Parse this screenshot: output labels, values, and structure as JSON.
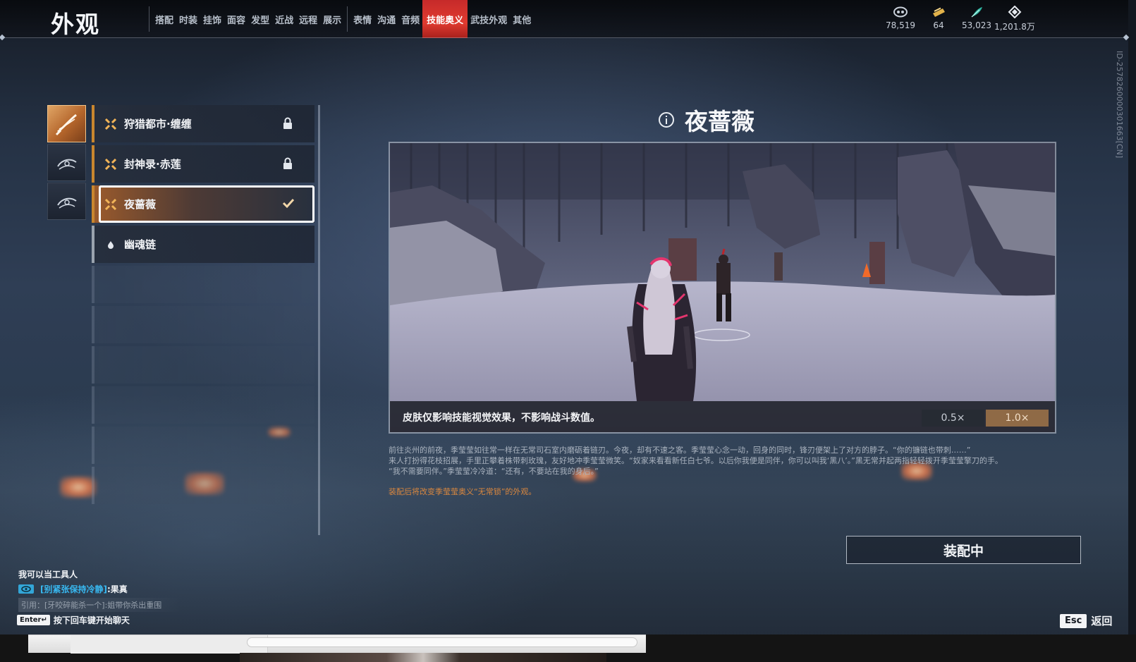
{
  "header": {
    "title": "外观",
    "tabs_group1": [
      "搭配",
      "时装",
      "挂饰",
      "面容",
      "发型",
      "近战",
      "远程",
      "展示"
    ],
    "tabs_group2": [
      "表情",
      "沟通",
      "音频",
      "技能奥义",
      "武技外观",
      "其他"
    ],
    "active_tab": "技能奥义"
  },
  "currencies": [
    {
      "icon": "mask-coin-icon",
      "value": "78,519"
    },
    {
      "icon": "gold-ticket-icon",
      "value": "64"
    },
    {
      "icon": "jade-feather-icon",
      "value": "53,023"
    },
    {
      "icon": "diamond-icon",
      "value": "1,201.8万"
    }
  ],
  "weapons": [
    {
      "icon": "sword-slash-icon",
      "active": true
    },
    {
      "icon": "blade-wave-icon",
      "active": false
    },
    {
      "icon": "blade-wave-icon",
      "active": false
    }
  ],
  "skins": [
    {
      "label": "狩猎都市·缠缠",
      "status": "locked",
      "rarity_icon": "star-burst-icon"
    },
    {
      "label": "封神录·赤莲",
      "status": "locked",
      "rarity_icon": "star-burst-icon"
    },
    {
      "label": "夜蔷薇",
      "status": "equipped",
      "rarity_icon": "star-burst-icon"
    },
    {
      "label": "幽魂链",
      "status": "default",
      "rarity_icon": "drop-icon"
    }
  ],
  "detail": {
    "title": "夜蔷薇",
    "caption": "皮肤仅影响技能视觉效果，不影响战斗数值。",
    "speed_options": [
      "0.5×",
      "1.0×"
    ],
    "speed_selected": "1.0×",
    "description": [
      "前往炎州的前夜，季莹莹如往常一样在无常司石室内磨砺着链刃。今夜，却有不速之客。季莹莹心念一动，回身的同时，锋刃便架上了对方的脖子。“你的镰链也带刺……”",
      "来人打扮得花枝招展，手里正攀着株带刺玫瑰，友好地冲季莹莹微笑。“奴家来看看新任白七爷。以后你我便是同伴，你可以叫我‘黑八’。”黑无常并起两指轻轻拨开季莹莹擎刀的手。",
      "“我不需要同伴。”季莹莹冷冷道：“还有，不要站在我的身后。”"
    ],
    "note": "装配后将改变季莹莹奥义“无常锁”的外观。",
    "equip_button": "装配中",
    "id_text": "ID-2578260000301663[CN]"
  },
  "chat": {
    "line1": "我可以当工具人",
    "channel": "[别紧张保持冷静]",
    "message": ":果真",
    "quote": "引用：[牙咬碎能杀一个]:姐带你杀出重围",
    "enter_key": "Enter↵",
    "enter_hint": "按下回车键开始聊天"
  },
  "footer": {
    "esc_key": "Esc",
    "back_label": "返回"
  },
  "colors": {
    "accent_red": "#e03b30",
    "accent_orange": "#c9862e",
    "note_orange": "#d9873f",
    "chat_channel": "#38b8f0"
  }
}
